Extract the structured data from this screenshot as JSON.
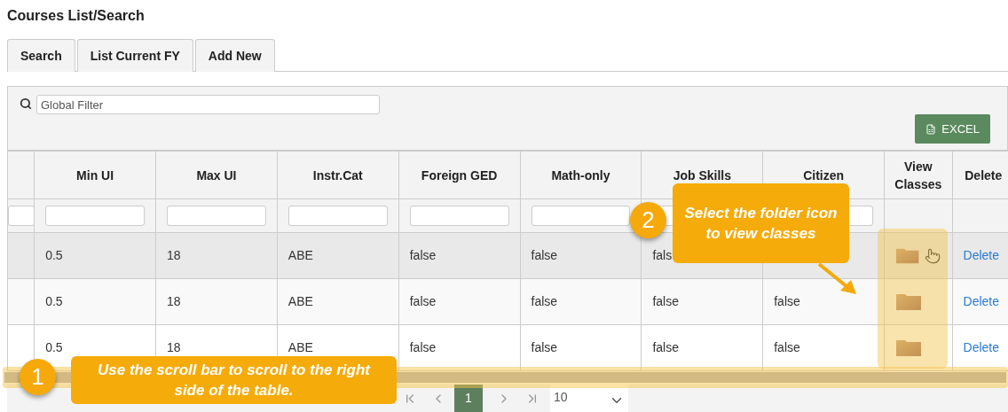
{
  "page_title": "Courses List/Search",
  "tabs": [
    {
      "label": "Search"
    },
    {
      "label": "List Current FY"
    },
    {
      "label": "Add New"
    }
  ],
  "global_filter": {
    "placeholder": "Global Filter"
  },
  "excel_button": "EXCEL",
  "table": {
    "columns": [
      "Min UI",
      "Max UI",
      "Instr.Cat",
      "Foreign GED",
      "Math-only",
      "Job Skills",
      "Citizen",
      "View Classes",
      "Delete"
    ],
    "rows": [
      {
        "highlighted": true,
        "pointer": true,
        "cells": [
          "0.5",
          "18",
          "ABE",
          "false",
          "false",
          "fals",
          null
        ],
        "delete": "Delete"
      },
      {
        "highlighted": false,
        "pointer": false,
        "cells": [
          "0.5",
          "18",
          "ABE",
          "false",
          "false",
          "false",
          "false"
        ],
        "delete": "Delete"
      },
      {
        "highlighted": false,
        "pointer": false,
        "cells": [
          "0.5",
          "18",
          "ABE",
          "false",
          "false",
          "false",
          "false"
        ],
        "delete": "Delete"
      }
    ]
  },
  "paginator": {
    "current_page": "1",
    "page_size": "10"
  },
  "callouts": [
    {
      "number": "1",
      "text": "Use the scroll bar to scroll to the right side of the table."
    },
    {
      "number": "2",
      "text": "Select the folder icon to view classes"
    }
  ]
}
